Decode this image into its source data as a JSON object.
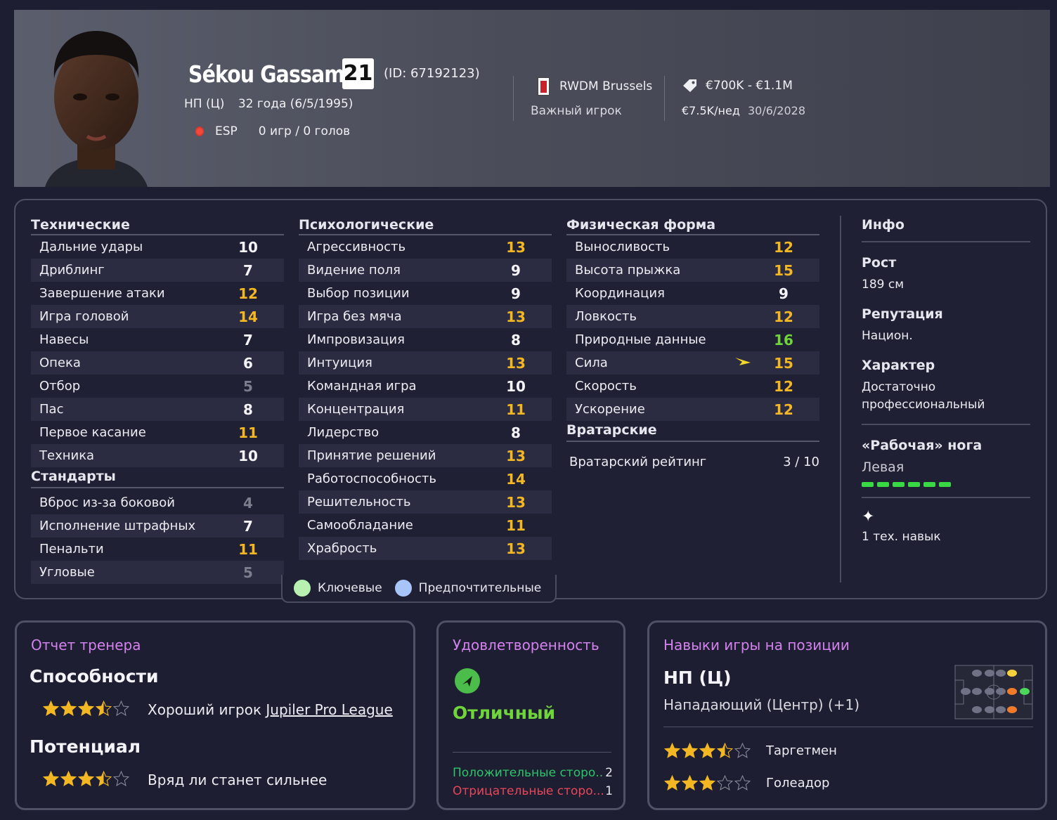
{
  "player": {
    "name": "Sékou Gassama",
    "number": "21",
    "id": "(ID: 67192123)",
    "position": "НП (Ц)",
    "age": "32 года (6/5/1995)",
    "nation": "ESP",
    "games": "0 игр / 0 голов"
  },
  "club": {
    "name": "RWDM Brussels",
    "status": "Важный игрок"
  },
  "contract": {
    "value": "€700K - €1.1M",
    "wage": "€7.5K/нед",
    "until": "30/6/2028"
  },
  "technical": {
    "title": "Технические",
    "items": [
      {
        "label": "Дальние удары",
        "value": "10",
        "color": "white"
      },
      {
        "label": "Дриблинг",
        "value": "7",
        "color": "white"
      },
      {
        "label": "Завершение атаки",
        "value": "12",
        "color": "yellow"
      },
      {
        "label": "Игра головой",
        "value": "14",
        "color": "yellow"
      },
      {
        "label": "Навесы",
        "value": "7",
        "color": "white"
      },
      {
        "label": "Опека",
        "value": "6",
        "color": "white"
      },
      {
        "label": "Отбор",
        "value": "5",
        "color": "grey"
      },
      {
        "label": "Пас",
        "value": "8",
        "color": "white"
      },
      {
        "label": "Первое касание",
        "value": "11",
        "color": "yellow"
      },
      {
        "label": "Техника",
        "value": "10",
        "color": "white"
      }
    ]
  },
  "set_pieces": {
    "title": "Стандарты",
    "items": [
      {
        "label": "Вброс из-за боковой",
        "value": "4",
        "color": "grey"
      },
      {
        "label": "Исполнение штрафных",
        "value": "7",
        "color": "white"
      },
      {
        "label": "Пенальти",
        "value": "11",
        "color": "yellow"
      },
      {
        "label": "Угловые",
        "value": "5",
        "color": "grey"
      }
    ]
  },
  "mental": {
    "title": "Психологические",
    "items": [
      {
        "label": "Агрессивность",
        "value": "13",
        "color": "yellow"
      },
      {
        "label": "Видение поля",
        "value": "9",
        "color": "white"
      },
      {
        "label": "Выбор позиции",
        "value": "9",
        "color": "white"
      },
      {
        "label": "Игра без мяча",
        "value": "13",
        "color": "yellow"
      },
      {
        "label": "Импровизация",
        "value": "8",
        "color": "white"
      },
      {
        "label": "Интуиция",
        "value": "13",
        "color": "yellow"
      },
      {
        "label": "Командная игра",
        "value": "10",
        "color": "white"
      },
      {
        "label": "Концентрация",
        "value": "11",
        "color": "yellow"
      },
      {
        "label": "Лидерство",
        "value": "8",
        "color": "white"
      },
      {
        "label": "Принятие решений",
        "value": "13",
        "color": "yellow"
      },
      {
        "label": "Работоспособность",
        "value": "14",
        "color": "yellow"
      },
      {
        "label": "Решительность",
        "value": "13",
        "color": "yellow"
      },
      {
        "label": "Самообладание",
        "value": "11",
        "color": "yellow"
      },
      {
        "label": "Храбрость",
        "value": "13",
        "color": "yellow"
      }
    ]
  },
  "physical": {
    "title": "Физическая форма",
    "items": [
      {
        "label": "Выносливость",
        "value": "12",
        "color": "yellow"
      },
      {
        "label": "Высота прыжка",
        "value": "15",
        "color": "yellow"
      },
      {
        "label": "Координация",
        "value": "9",
        "color": "white"
      },
      {
        "label": "Ловкость",
        "value": "12",
        "color": "yellow"
      },
      {
        "label": "Природные данные",
        "value": "16",
        "color": "green"
      },
      {
        "label": "Сила",
        "value": "15",
        "color": "yellow",
        "trend": "up"
      },
      {
        "label": "Скорость",
        "value": "12",
        "color": "yellow"
      },
      {
        "label": "Ускорение",
        "value": "12",
        "color": "yellow"
      }
    ]
  },
  "goalkeeping": {
    "title": "Вратарские",
    "label": "Вратарский рейтинг",
    "value": "3 / 10"
  },
  "info": {
    "title": "Инфо",
    "height_label": "Рост",
    "height": "189 см",
    "reputation_label": "Репутация",
    "reputation": "Национ.",
    "character_label": "Характер",
    "character": "Достаточно профессиональный",
    "foot_label": "«Рабочая» нога",
    "foot": "Левая",
    "foot_level": 6,
    "skills": "1 тех. навык"
  },
  "legend": {
    "key": "Ключевые",
    "preferred": "Предпочтительные"
  },
  "coach_report": {
    "title": "Отчет тренера",
    "ability_label": "Способности",
    "ability_stars": 3.5,
    "ability_text": "Хороший игрок",
    "ability_league": "Jupiler Pro League",
    "potential_label": "Потенциал",
    "potential_stars": 3.5,
    "potential_text": "Вряд ли станет сильнее"
  },
  "happiness": {
    "title": "Удовлетворенность",
    "status": "Отличный",
    "positive_label": "Положительные сторо...",
    "positive_count": "2",
    "negative_label": "Отрицательные сторо...",
    "negative_count": "1"
  },
  "position_skills": {
    "title": "Навыки игры на позиции",
    "position": "НП (Ц)",
    "position_full": "Нападающий (Центр) (+1)",
    "roles": [
      {
        "name": "Таргетмен",
        "stars": 3.5
      },
      {
        "name": "Голеадор",
        "stars": 3
      }
    ]
  },
  "colors": {
    "accent": "#d482ee",
    "green": "#6fd53b",
    "yellow": "#f4b724",
    "positive": "#2ec46a",
    "negative": "#e8475a"
  }
}
